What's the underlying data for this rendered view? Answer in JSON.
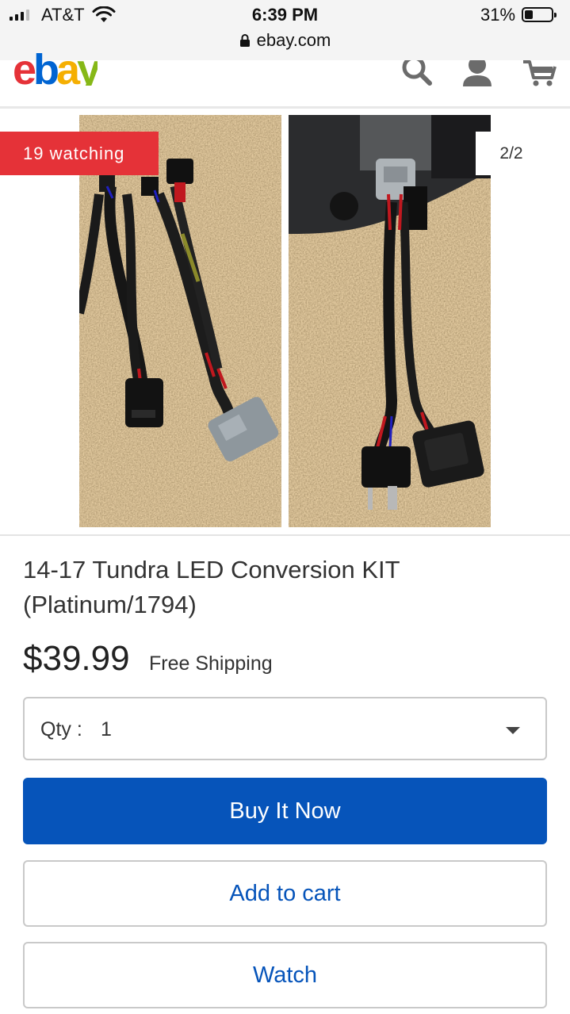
{
  "status_bar": {
    "carrier": "AT&T",
    "time": "6:39 PM",
    "battery_percent": "31%",
    "battery_level": 0.31,
    "url": "ebay.com"
  },
  "header": {
    "logo_letters": [
      "e",
      "b",
      "a",
      "y"
    ],
    "logo_colors": [
      "#e53238",
      "#0064d2",
      "#f5af02",
      "#86b817"
    ],
    "icons": [
      "search-icon",
      "account-icon",
      "cart-icon"
    ]
  },
  "gallery": {
    "watching_badge": "19 watching",
    "counter": "2/2"
  },
  "product": {
    "title": "14-17 Tundra LED Conversion KIT (Platinum/1794)",
    "price": "$39.99",
    "shipping": "Free Shipping",
    "qty_label": "Qty :",
    "qty_value": "1"
  },
  "actions": {
    "buy_now": "Buy It Now",
    "add_to_cart": "Add to cart",
    "watch": "Watch"
  },
  "colors": {
    "brand_red": "#e53238",
    "action_blue": "#0654ba"
  }
}
